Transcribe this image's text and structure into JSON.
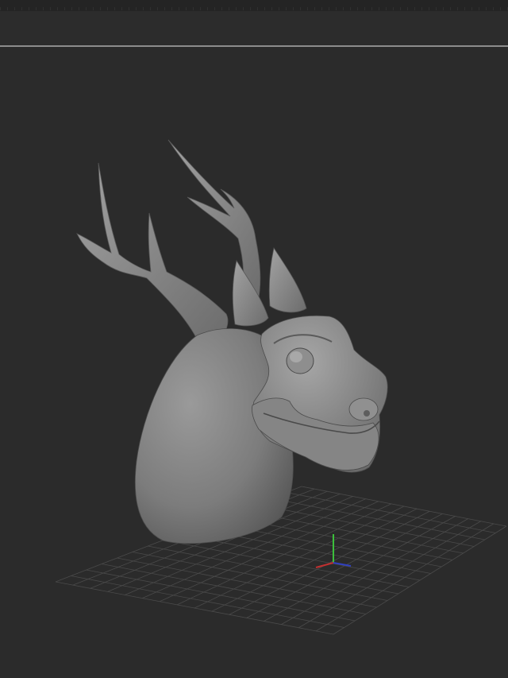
{
  "app": {
    "colors": {
      "background": "#2b2b2b",
      "top_bar": "#242424",
      "separator": "#8c8c8c",
      "grid_line": "#4a4a4a",
      "model_base": "#8a8a8a",
      "axis_x": "#c03030",
      "axis_y": "#3cc03c",
      "axis_z": "#3040c0"
    }
  },
  "viewport": {
    "model_icon": "dragon-head-sculpt",
    "grid": true,
    "gizmo_icon": "xyz-axis-gizmo"
  }
}
